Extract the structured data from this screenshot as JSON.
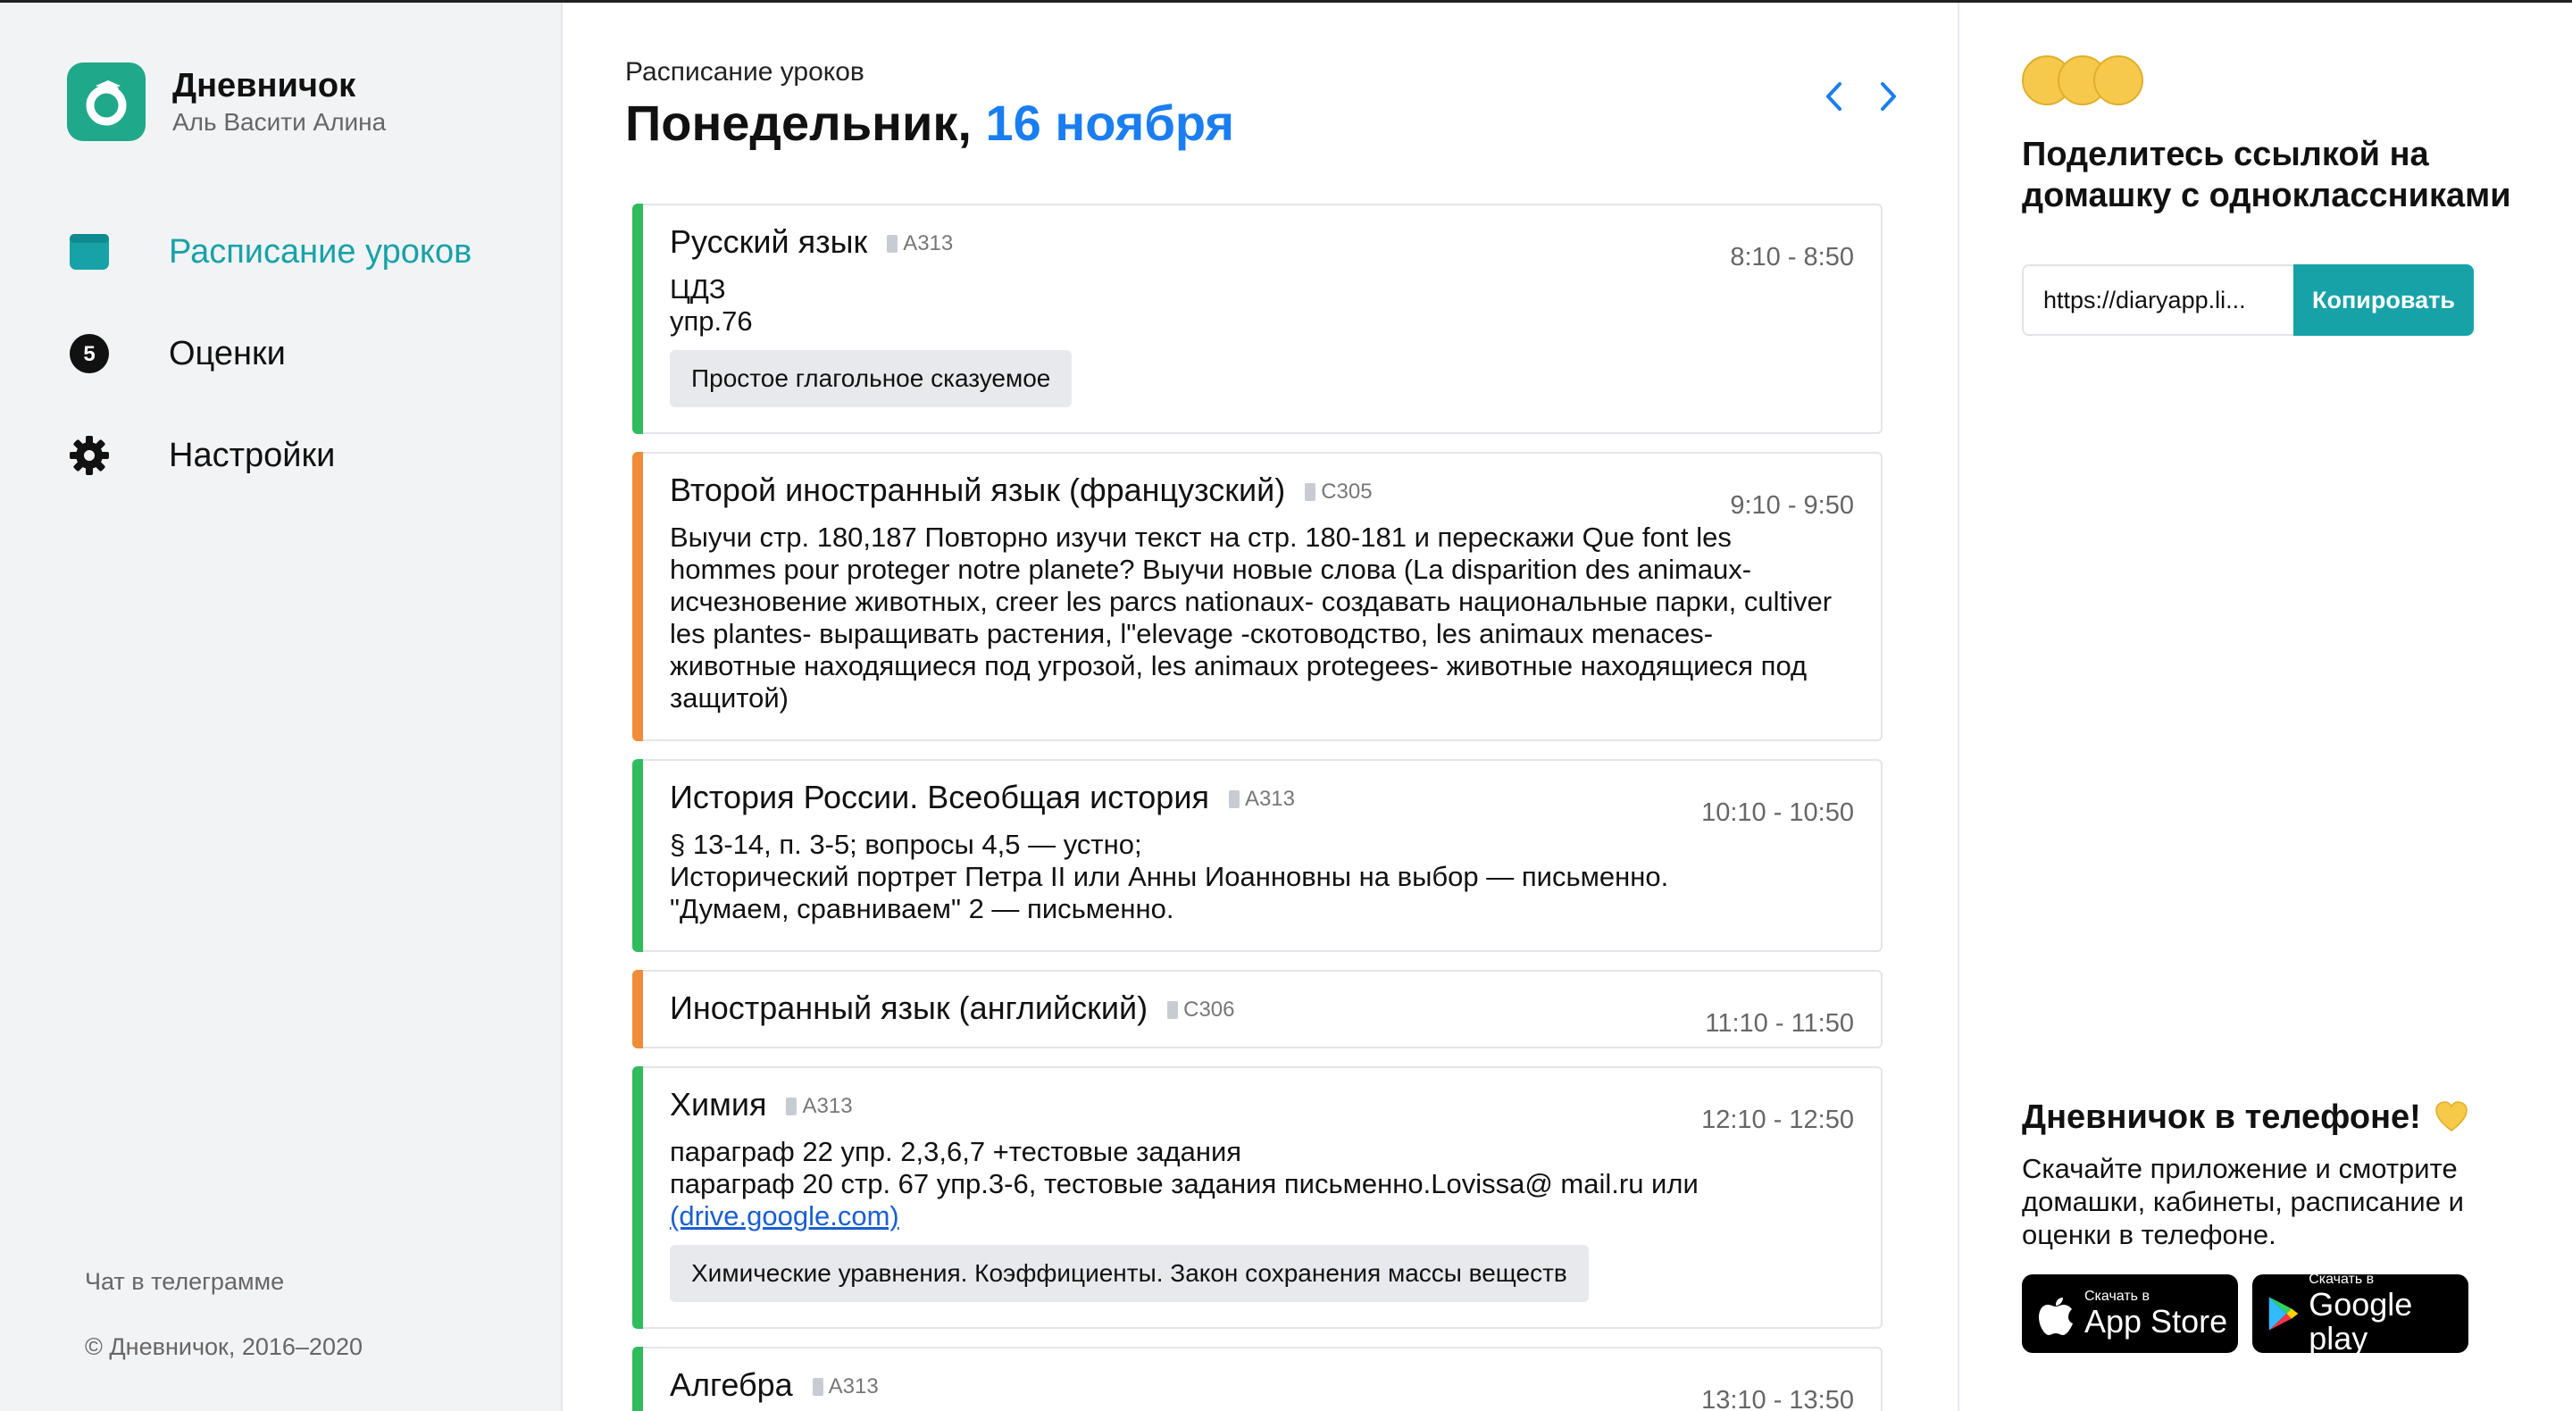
{
  "brand": {
    "title": "Дневничок",
    "subtitle": "Аль Васити Алина",
    "accent_color": "#1fa88a"
  },
  "nav": {
    "items": [
      {
        "label": "Расписание уроков",
        "icon": "calendar-icon",
        "active": true
      },
      {
        "label": "Оценки",
        "icon": "grade-badge-icon",
        "badge": "5",
        "active": false
      },
      {
        "label": "Настройки",
        "icon": "gear-icon",
        "active": false
      }
    ],
    "active_color": "#17a2a8"
  },
  "footer": {
    "telegram": "Чат в телеграмме",
    "copyright": "© Дневничок, 2016–2020"
  },
  "header": {
    "subtitle": "Расписание уроков",
    "day": "Понедельник,",
    "date": "16 ноября"
  },
  "lessons": [
    {
      "subject": "Русский язык",
      "room": "А313",
      "time": "8:10 - 8:50",
      "color": "#2ebc5c",
      "homework": "ЦДЗ\nупр.76",
      "topic": "Простое глагольное сказуемое"
    },
    {
      "subject": "Второй иностранный язык (французский)",
      "room": "С305",
      "time": "9:10 - 9:50",
      "color": "#f08c38",
      "homework": "Выучи стр. 180,187 Повторно изучи текст на стр. 180-181 и перескажи Que font les hommes pour proteger notre planete? Выучи новые слова (La disparition des animaux- исчезновение животных, creer les parcs nationaux- создавать национальные парки, cultiver les plantes- выращивать растения, l\"elevage -скотоводство, les animaux menaces- животные находящиеся под угрозой, les animaux protegees- животные находящиеся под защитой)"
    },
    {
      "subject": "История России. Всеобщая история",
      "room": "А313",
      "time": "10:10 - 10:50",
      "color": "#2ebc5c",
      "homework": "§ 13-14, п. 3-5; вопросы 4,5 — устно;\nИсторический портрет Петра II или Анны Иоанновны на выбор — письменно.\n\"Думаем, сравниваем\" 2 — письменно."
    },
    {
      "subject": "Иностранный язык (английский)",
      "room": "С306",
      "time": "11:10 - 11:50",
      "color": "#f08c38"
    },
    {
      "subject": "Химия",
      "room": "А313",
      "time": "12:10 - 12:50",
      "color": "#2ebc5c",
      "homework": "параграф 22 упр. 2,3,6,7 +тестовые задания\nпараграф 20 стр. 67 упр.3-6, тестовые задания письменно.Lovissa@ mail.ru или",
      "link": "(drive.google.com)",
      "topic": "Химические уравнения. Коэффициенты. Закон сохранения массы веществ"
    },
    {
      "subject": "Алгебра",
      "room": "А313",
      "time": "13:10 - 13:50",
      "color": "#2ebc5c"
    }
  ],
  "share": {
    "title": "Поделитесь ссылкой на домашку с одноклассниками",
    "url": "https://diaryapp.li...",
    "button": "Копировать"
  },
  "promo": {
    "title": "Дневничок в телефоне!",
    "text": "Скачайте приложение и смотрите домашки, кабинеты, расписание и оценки в телефоне.",
    "appstore_small": "Скачать в",
    "appstore_big": "App Store",
    "googleplay_small": "Скачать в",
    "googleplay_big": "Google play"
  }
}
